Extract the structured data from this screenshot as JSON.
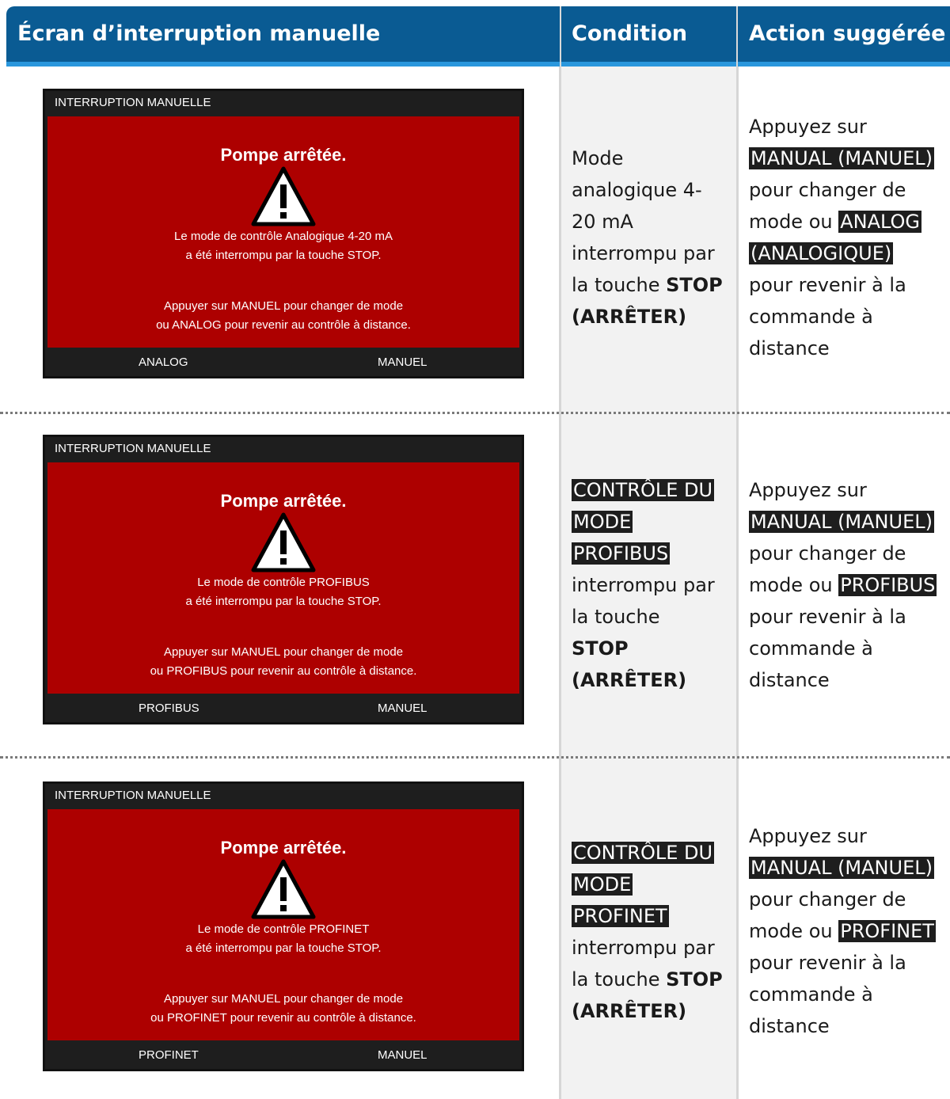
{
  "header": {
    "col1": "Écran d’interruption manuelle",
    "col2": "Condition",
    "col3": "Action suggérée"
  },
  "rows": [
    {
      "screen": {
        "title": "INTERRUPTION MANUELLE",
        "heading": "Pompe arrêtée.",
        "icon": "warning-triangle-icon",
        "msg1": "Le mode de contrôle Analogique 4-20 mA",
        "msg2": "a été interrompu par la touche STOP.",
        "msg3": "Appuyer sur MANUEL pour changer de mode",
        "msg4": "ou ANALOG pour revenir au contrôle à distance.",
        "soft_left": "ANALOG",
        "soft_right": "MANUEL"
      },
      "condition": {
        "l1": "Mode",
        "l2": "analogique 4-",
        "l3": "20 mA",
        "l4": "interrompu par",
        "l5a": "la touche ",
        "l5b": "STOP",
        "l6": "(ARRÊTER)"
      },
      "action": {
        "l1": "Appuyez sur",
        "l2": "MANUAL (MANUEL)",
        "l3": "pour changer de",
        "l4a": "mode ou ",
        "l4b": "ANALOG",
        "l5": "(ANALOGIQUE)",
        "l6": "pour revenir à la",
        "l7": "commande à",
        "l8": "distance"
      }
    },
    {
      "screen": {
        "title": "INTERRUPTION MANUELLE",
        "heading": "Pompe arrêtée.",
        "icon": "warning-triangle-icon",
        "msg1": "Le mode de contrôle PROFIBUS",
        "msg2": "a été interrompu par la touche STOP.",
        "msg3": "Appuyer sur MANUEL pour changer de mode",
        "msg4": "ou PROFIBUS pour revenir au contrôle à distance.",
        "soft_left": "PROFIBUS",
        "soft_right": "MANUEL"
      },
      "condition": {
        "l1": "CONTRÔLE DU",
        "l2": "MODE",
        "l3": "PROFIBUS",
        "l4": "interrompu par",
        "l5": "la touche",
        "l6": "STOP",
        "l7": "(ARRÊTER)"
      },
      "action": {
        "l1": "Appuyez sur",
        "l2": "MANUAL (MANUEL)",
        "l3": "pour changer de",
        "l4a": "mode ou ",
        "l4b": "PROFIBUS",
        "l5": "pour revenir à la",
        "l6": "commande à",
        "l7": "distance"
      }
    },
    {
      "screen": {
        "title": "INTERRUPTION MANUELLE",
        "heading": "Pompe arrêtée.",
        "icon": "warning-triangle-icon",
        "msg1": "Le mode de contrôle PROFINET",
        "msg2": "a été interrompu par la touche STOP.",
        "msg3": "Appuyer sur MANUEL pour changer de mode",
        "msg4": "ou PROFINET pour revenir au contrôle à distance.",
        "soft_left": "PROFINET",
        "soft_right": "MANUEL"
      },
      "condition": {
        "l1": "CONTRÔLE DU",
        "l2": "MODE",
        "l3": "PROFINET",
        "l4": "interrompu par",
        "l5a": "la touche ",
        "l5b": "STOP",
        "l6": "(ARRÊTER)"
      },
      "action": {
        "l1": "Appuyez sur",
        "l2": "MANUAL (MANUEL)",
        "l3": "pour changer de",
        "l4a": "mode ou ",
        "l4b": "PROFINET",
        "l5": "pour revenir à la",
        "l6": "commande à",
        "l7": "distance"
      }
    }
  ]
}
